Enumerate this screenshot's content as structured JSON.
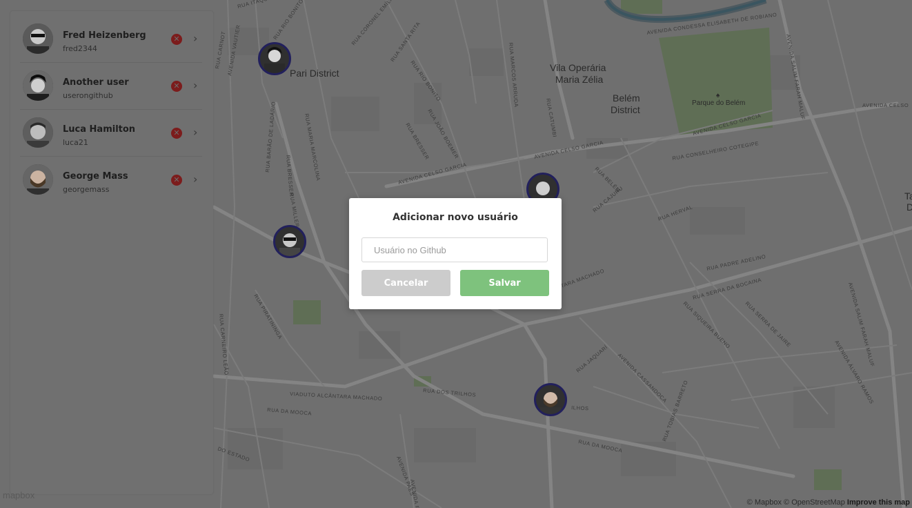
{
  "map": {
    "places": [
      {
        "label": "Pari District"
      },
      {
        "label": "Vila Operária"
      },
      {
        "label": "Maria Zélia"
      },
      {
        "label": "Belém"
      },
      {
        "label": "District"
      },
      {
        "label": "Parque do Belém"
      },
      {
        "label": "Ta"
      },
      {
        "label": "D"
      }
    ],
    "streets": [
      "RUA ITAQUI",
      "RUA RIO BONITO",
      "RUA CORONEL EMÍLIO",
      "AVENIDA VAUTIER",
      "RUA CARNOT",
      "RUA SANTA RITA",
      "RUA RIO BONITO",
      "RUA MARCOS ARRUDA",
      "RUA CATUMBI",
      "RUA JOÃO BOEMER",
      "RUA BRESSER",
      "AVENIDA CELSO GARCIA",
      "RUA BARÃO DE LADÁRIO",
      "RUA MARIA MARCOLINA",
      "RUA BELÉM",
      "RUA CAJURU",
      "RUA HERVAL",
      "RUA CONSELHEIRO COTEGIPE",
      "AVENIDA CELSO GARCIA",
      "AVENIDA CONDESSA ELISABETH DE ROBIANO",
      "AVENIDA SALIM FARAH MALUF",
      "RUA PADRE ADELINO",
      "RUA SERRA DA BOCAINA",
      "RUA SIQUEIRA BUENO",
      "RUA SERRA DE JAIRE",
      "AVENIDA ÁLVARO RAMOS",
      "VIADUTO ALCÂNTARA MACHADO",
      "RUA DOS TRILHOS",
      "RUA DA MOOCA",
      "AVENIDA CASSANDOCA",
      "RUA TOBIAS BARRETO",
      "RUA DA MOOCA",
      "RUA PIRATININGA",
      "RUA CARNEIRO LEÃO",
      "DO ESTADO",
      "AVENIDA PAES",
      "RUA JAQUARÍ",
      "TARA MACHADO",
      "AVENIDA SALIM FARAH MALUF",
      "AVENIDA CELSO",
      "AVENIDA CELSO GARCIA",
      "RUA BRESSER",
      "RUA MILLER",
      "AVENIDA PREST",
      "ILHOS"
    ],
    "attribution": {
      "mapbox": "© Mapbox",
      "osm": "© OpenStreetMap",
      "improve": "Improve this map"
    },
    "logo": "mapbox",
    "marker_ring_color": "#22205c"
  },
  "sidebar": {
    "users": [
      {
        "name": "Fred Heizenberg",
        "login": "fred2344",
        "remove_icon": "close-circle-icon",
        "open_icon": "chevron-right-icon"
      },
      {
        "name": "Another user",
        "login": "userongithub",
        "remove_icon": "close-circle-icon",
        "open_icon": "chevron-right-icon"
      },
      {
        "name": "Luca Hamilton",
        "login": "luca21",
        "remove_icon": "close-circle-icon",
        "open_icon": "chevron-right-icon"
      },
      {
        "name": "George Mass",
        "login": "georgemass",
        "remove_icon": "close-circle-icon",
        "open_icon": "chevron-right-icon"
      }
    ]
  },
  "modal": {
    "title": "Adicionar novo usuário",
    "input": {
      "placeholder": "Usuário no Github",
      "value": ""
    },
    "cancel_label": "Cancelar",
    "save_label": "Salvar",
    "save_color": "#7ec27d",
    "cancel_color": "#cccccc"
  }
}
